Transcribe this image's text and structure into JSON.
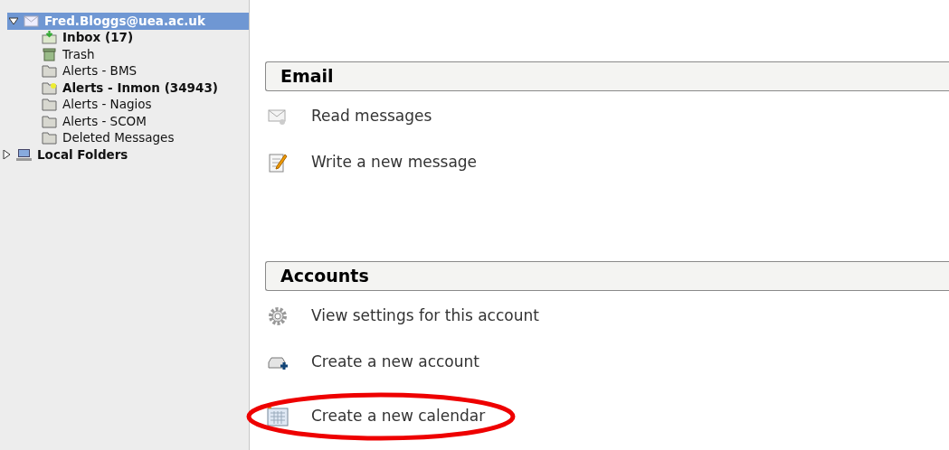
{
  "folder_tree": [
    {
      "label": "Fred.Bloggs@uea.ac.uk",
      "kind": "account",
      "selected": true,
      "expanded": true,
      "unread": true,
      "children": [
        {
          "label": "Inbox (17)",
          "kind": "inbox",
          "selected": false,
          "unread": true
        },
        {
          "label": "Trash",
          "kind": "trash",
          "selected": false,
          "unread": false
        },
        {
          "label": "Alerts - BMS",
          "kind": "folder",
          "selected": false,
          "unread": false
        },
        {
          "label": "Alerts - Inmon (34943)",
          "kind": "new-folder",
          "selected": false,
          "unread": true
        },
        {
          "label": "Alerts - Nagios",
          "kind": "folder",
          "selected": false,
          "unread": false
        },
        {
          "label": "Alerts - SCOM",
          "kind": "folder",
          "selected": false,
          "unread": false
        },
        {
          "label": "Deleted Messages",
          "kind": "folder",
          "selected": false,
          "unread": false
        }
      ]
    },
    {
      "label": "Local Folders",
      "kind": "computer",
      "selected": false,
      "expanded": false,
      "unread": true
    }
  ],
  "sections": [
    {
      "title": "Email",
      "items": [
        {
          "label": "Read messages",
          "kind": "read",
          "circled": false
        },
        {
          "label": "Write a new message",
          "kind": "write",
          "circled": false
        }
      ]
    },
    {
      "title": "Accounts",
      "items": [
        {
          "label": "View settings for this account",
          "kind": "settings",
          "circled": false
        },
        {
          "label": "Create a new account",
          "kind": "account",
          "circled": false
        },
        {
          "label": "Create a new calendar",
          "kind": "calendar",
          "circled": true
        }
      ]
    }
  ]
}
